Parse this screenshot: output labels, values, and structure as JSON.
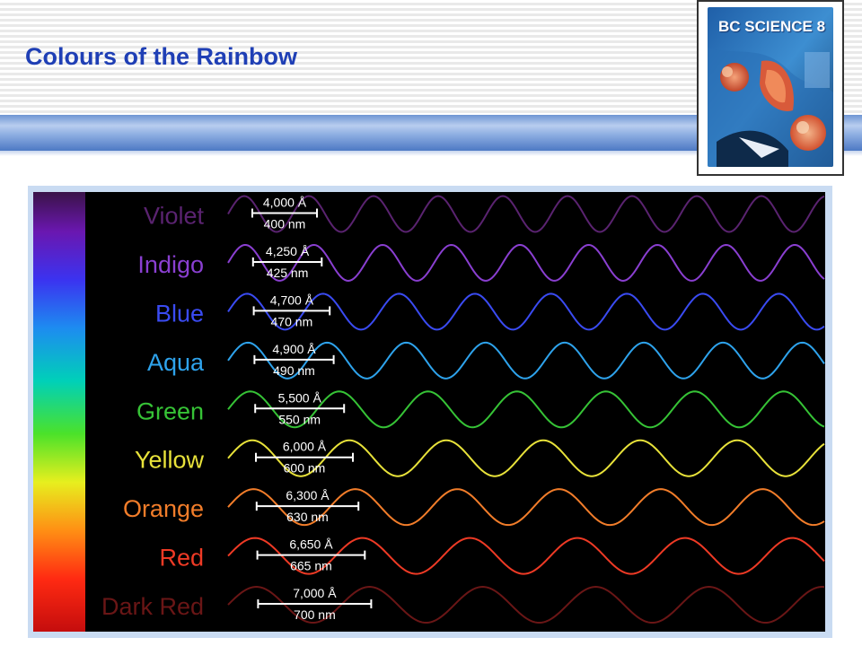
{
  "slide": {
    "title": "Colours of the Rainbow",
    "accent_color": "#1f3fb5"
  },
  "book_cover": {
    "title": "BC SCIENCE 8"
  },
  "spectrum": {
    "bands": [
      {
        "name": "Violet",
        "angstrom": "4,000 Å",
        "nm": "400 nm",
        "color": "#5a2370"
      },
      {
        "name": "Indigo",
        "angstrom": "4,250 Å",
        "nm": "425 nm",
        "color": "#8a3fd1"
      },
      {
        "name": "Blue",
        "angstrom": "4,700 Å",
        "nm": "470 nm",
        "color": "#3a4bf2"
      },
      {
        "name": "Aqua",
        "angstrom": "4,900 Å",
        "nm": "490 nm",
        "color": "#2ea3ec"
      },
      {
        "name": "Green",
        "angstrom": "5,500 Å",
        "nm": "550 nm",
        "color": "#36c336"
      },
      {
        "name": "Yellow",
        "angstrom": "6,000 Å",
        "nm": "600 nm",
        "color": "#e8e23a"
      },
      {
        "name": "Orange",
        "angstrom": "6,300 Å",
        "nm": "630 nm",
        "color": "#f27d2a"
      },
      {
        "name": "Red",
        "angstrom": "6,650 Å",
        "nm": "665 nm",
        "color": "#ee3a25"
      },
      {
        "name": "Dark Red",
        "angstrom": "7,000 Å",
        "nm": "700 nm",
        "color": "#6a1616"
      }
    ]
  }
}
